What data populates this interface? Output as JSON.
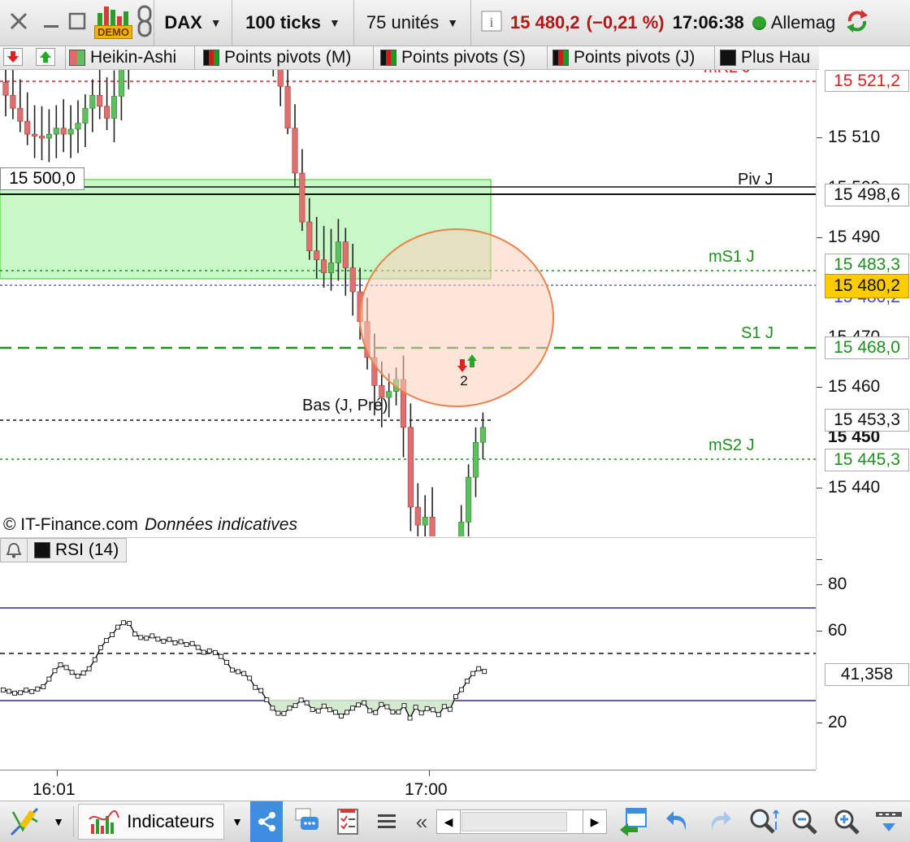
{
  "toolbar": {
    "instrument": "DAX",
    "tick_setting": "100 ticks",
    "unit_setting": "75 unités",
    "last_price": "15 480,2",
    "change_pct": "(−0,21 %)",
    "time": "17:06:38",
    "market": "Allemag",
    "demo_badge": "DEMO"
  },
  "tabs": [
    {
      "label": "Heikin-Ashi"
    },
    {
      "label": "Points pivots (M)"
    },
    {
      "label": "Points pivots (S)"
    },
    {
      "label": "Points pivots (J)"
    },
    {
      "label": "Plus Hau"
    }
  ],
  "price_chart": {
    "price_badge": "15 500,0",
    "copyright": "© IT-Finance.com",
    "disclaimer": "Données indicatives",
    "levels": [
      {
        "label": "mR2 J",
        "value": "15 521,2",
        "color": "#e02020"
      },
      {
        "label": "Piv J",
        "value": "15 498,6",
        "color": "#111111"
      },
      {
        "label": "mS1 J",
        "value": "15 483,3",
        "color": "#1f8f1f"
      },
      {
        "label": "S1 J",
        "value": "15 468,0",
        "color": "#1f8f1f"
      },
      {
        "label": "Bas (J, Pré)",
        "value": "15 453,3",
        "color": "#111111"
      },
      {
        "label": "mS2 J",
        "value": "15 445,3",
        "color": "#1f8f1f"
      }
    ],
    "current_price": "15 480,2",
    "stacked_behind_value": "15 480,2",
    "axis_ticks": [
      "15 520",
      "15 510",
      "15 500",
      "15 490",
      "15 480",
      "15 470",
      "15 460",
      "15 450",
      "15 440"
    ],
    "signal_count": "2"
  },
  "rsi": {
    "label": "RSI (14)",
    "value": "41,358",
    "axis_ticks": [
      "80",
      "60",
      "40",
      "20"
    ],
    "overbought": 70,
    "oversold": 30,
    "midline": 50
  },
  "time_axis": {
    "ticks": [
      "16:01",
      "17:00"
    ]
  },
  "bottombar": {
    "indicators_label": "Indicateurs"
  },
  "colors": {
    "bull": "#5cc05c",
    "bear": "#e07070",
    "zone_fill": "#c8f7c8",
    "circle_fill": "#fde3d7",
    "circle_stroke": "#f0804a",
    "price_box": "#ffcc00",
    "rsi_band": "#2b2b8f"
  },
  "chart_data": {
    "type": "candlestick",
    "title": "",
    "ylim": [
      15436,
      15525
    ],
    "x": [
      "16:01",
      "17:00"
    ],
    "candles": [
      {
        "o": 15515.6,
        "h": 15518.5,
        "l": 15512.2,
        "c": 15514.3
      },
      {
        "o": 15514.3,
        "h": 15517.2,
        "l": 15511.9,
        "c": 15513.0
      },
      {
        "o": 15513.0,
        "h": 15515.9,
        "l": 15510.6,
        "c": 15511.7
      },
      {
        "o": 15511.7,
        "h": 15514.6,
        "l": 15509.3,
        "c": 15510.4
      },
      {
        "o": 15510.4,
        "h": 15513.3,
        "l": 15508.0,
        "c": 15510.2
      },
      {
        "o": 15510.2,
        "h": 15513.2,
        "l": 15507.8,
        "c": 15510.0
      },
      {
        "o": 15510.0,
        "h": 15512.9,
        "l": 15507.6,
        "c": 15510.4
      },
      {
        "o": 15510.4,
        "h": 15513.3,
        "l": 15508.0,
        "c": 15511.0
      },
      {
        "o": 15511.0,
        "h": 15513.9,
        "l": 15508.6,
        "c": 15510.4
      },
      {
        "o": 15510.4,
        "h": 15513.3,
        "l": 15508.0,
        "c": 15510.9
      },
      {
        "o": 15510.9,
        "h": 15513.8,
        "l": 15508.5,
        "c": 15511.5
      },
      {
        "o": 15511.5,
        "h": 15514.4,
        "l": 15509.1,
        "c": 15513.0
      },
      {
        "o": 15513.0,
        "h": 15515.9,
        "l": 15510.6,
        "c": 15514.3
      },
      {
        "o": 15514.3,
        "h": 15517.2,
        "l": 15511.9,
        "c": 15513.2
      },
      {
        "o": 15513.2,
        "h": 15516.1,
        "l": 15510.8,
        "c": 15512.0
      },
      {
        "o": 15512.0,
        "h": 15516.8,
        "l": 15509.6,
        "c": 15514.2
      },
      {
        "o": 15514.2,
        "h": 15519.4,
        "l": 15511.8,
        "c": 15517.3
      },
      {
        "o": 15517.3,
        "h": 15522.1,
        "l": 15514.9,
        "c": 15520.0
      },
      {
        "o": 15520.0,
        "h": 15524.9,
        "l": 15517.6,
        "c": 15523.0
      },
      {
        "o": 15523.0,
        "h": 15527.8,
        "l": 15520.6,
        "c": 15525.0
      },
      {
        "o": 15525.0,
        "h": 15528.8,
        "l": 15522.6,
        "c": 15526.5
      },
      {
        "o": 15526.5,
        "h": 15530.3,
        "l": 15524.1,
        "c": 15527.8
      },
      {
        "o": 15527.8,
        "h": 15531.7,
        "l": 15525.4,
        "c": 15529.3
      },
      {
        "o": 15529.3,
        "h": 15533.1,
        "l": 15526.9,
        "c": 15530.5
      },
      {
        "o": 15530.5,
        "h": 15534.4,
        "l": 15528.1,
        "c": 15531.2
      },
      {
        "o": 15531.2,
        "h": 15535.0,
        "l": 15528.8,
        "c": 15530.0
      },
      {
        "o": 15530.0,
        "h": 15533.9,
        "l": 15527.6,
        "c": 15528.5
      },
      {
        "o": 15528.5,
        "h": 15532.4,
        "l": 15526.1,
        "c": 15527.0
      },
      {
        "o": 15527.0,
        "h": 15529.9,
        "l": 15524.6,
        "c": 15526.2
      },
      {
        "o": 15526.2,
        "h": 15528.1,
        "l": 15523.8,
        "c": 15525.3
      },
      {
        "o": 15525.3,
        "h": 15527.7,
        "l": 15522.9,
        "c": 15524.7
      },
      {
        "o": 15524.7,
        "h": 15527.1,
        "l": 15522.3,
        "c": 15525.1
      },
      {
        "o": 15525.1,
        "h": 15527.5,
        "l": 15522.7,
        "c": 15524.4
      },
      {
        "o": 15524.4,
        "h": 15526.8,
        "l": 15522.0,
        "c": 15523.0
      },
      {
        "o": 15523.0,
        "h": 15525.4,
        "l": 15520.6,
        "c": 15522.5
      },
      {
        "o": 15522.5,
        "h": 15524.9,
        "l": 15520.1,
        "c": 15523.0
      },
      {
        "o": 15523.0,
        "h": 15525.4,
        "l": 15520.6,
        "c": 15521.0
      },
      {
        "o": 15521.0,
        "h": 15523.4,
        "l": 15516.2,
        "c": 15518.0
      },
      {
        "o": 15518.0,
        "h": 15520.4,
        "l": 15513.2,
        "c": 15515.2
      },
      {
        "o": 15515.2,
        "h": 15517.6,
        "l": 15510.4,
        "c": 15511.0
      },
      {
        "o": 15511.0,
        "h": 15513.4,
        "l": 15505.2,
        "c": 15506.5
      },
      {
        "o": 15506.5,
        "h": 15508.9,
        "l": 15500.7,
        "c": 15501.6
      },
      {
        "o": 15501.6,
        "h": 15504.0,
        "l": 15497.8,
        "c": 15498.7
      },
      {
        "o": 15498.7,
        "h": 15502.1,
        "l": 15495.9,
        "c": 15497.8
      },
      {
        "o": 15497.8,
        "h": 15501.2,
        "l": 15495.0,
        "c": 15496.5
      },
      {
        "o": 15496.5,
        "h": 15500.9,
        "l": 15494.7,
        "c": 15497.5
      },
      {
        "o": 15497.5,
        "h": 15501.9,
        "l": 15495.7,
        "c": 15499.6
      },
      {
        "o": 15499.6,
        "h": 15501.0,
        "l": 15494.2,
        "c": 15497.0
      },
      {
        "o": 15497.0,
        "h": 15499.4,
        "l": 15492.2,
        "c": 15494.6
      },
      {
        "o": 15494.6,
        "h": 15497.0,
        "l": 15489.8,
        "c": 15491.6
      },
      {
        "o": 15491.6,
        "h": 15494.0,
        "l": 15486.8,
        "c": 15488.0
      },
      {
        "o": 15488.0,
        "h": 15490.4,
        "l": 15482.2,
        "c": 15485.2
      },
      {
        "o": 15485.2,
        "h": 15487.6,
        "l": 15481.0,
        "c": 15484.0
      },
      {
        "o": 15484.0,
        "h": 15486.4,
        "l": 15482.0,
        "c": 15484.6
      },
      {
        "o": 15484.6,
        "h": 15487.0,
        "l": 15483.2,
        "c": 15485.8
      },
      {
        "o": 15485.8,
        "h": 15488.2,
        "l": 15478.0,
        "c": 15481.0
      },
      {
        "o": 15481.0,
        "h": 15483.4,
        "l": 15470.6,
        "c": 15473.0
      },
      {
        "o": 15473.0,
        "h": 15475.4,
        "l": 15468.6,
        "c": 15471.2
      },
      {
        "o": 15471.2,
        "h": 15474.2,
        "l": 15467.0,
        "c": 15472.0
      },
      {
        "o": 15472.0,
        "h": 15475.0,
        "l": 15465.0,
        "c": 15467.0
      },
      {
        "o": 15467.0,
        "h": 15470.0,
        "l": 15461.7,
        "c": 15463.5
      },
      {
        "o": 15463.5,
        "h": 15467.3,
        "l": 15461.5,
        "c": 15465.5
      },
      {
        "o": 15465.5,
        "h": 15469.3,
        "l": 15463.0,
        "c": 15467.3
      },
      {
        "o": 15467.3,
        "h": 15473.2,
        "l": 15465.0,
        "c": 15471.5
      },
      {
        "o": 15471.5,
        "h": 15477.3,
        "l": 15469.5,
        "c": 15476.0
      },
      {
        "o": 15476.0,
        "h": 15481.0,
        "l": 15474.0,
        "c": 15479.5
      },
      {
        "o": 15479.5,
        "h": 15482.5,
        "l": 15477.8,
        "c": 15481.0
      }
    ],
    "rsi": [
      34.2,
      33.6,
      32.8,
      33.0,
      34.1,
      33.5,
      34.6,
      35.6,
      38.9,
      42.5,
      45.1,
      43.9,
      41.8,
      40.2,
      41.5,
      43.4,
      47.3,
      52.5,
      55.6,
      58.1,
      61.4,
      63.3,
      63.0,
      58.4,
      56.9,
      56.6,
      57.6,
      56.2,
      55.3,
      56.1,
      54.6,
      55.1,
      53.9,
      54.3,
      52.6,
      50.5,
      51.1,
      50.4,
      48.7,
      46.1,
      42.8,
      42.1,
      41.3,
      39.3,
      35.3,
      33.9,
      29.9,
      26.3,
      24.1,
      24.0,
      26.3,
      27.4,
      29.8,
      28.6,
      25.7,
      25.1,
      27.2,
      25.6,
      24.5,
      22.9,
      24.5,
      26.3,
      27.7,
      28.6,
      25.2,
      24.4,
      27.9,
      26.9,
      24.6,
      24.6,
      27.4,
      22.0,
      26.7,
      24.2,
      26.1,
      25.6,
      23.5,
      27.0,
      25.8,
      31.3,
      34.3,
      38.0,
      41.3,
      43.4,
      42.2
    ]
  }
}
